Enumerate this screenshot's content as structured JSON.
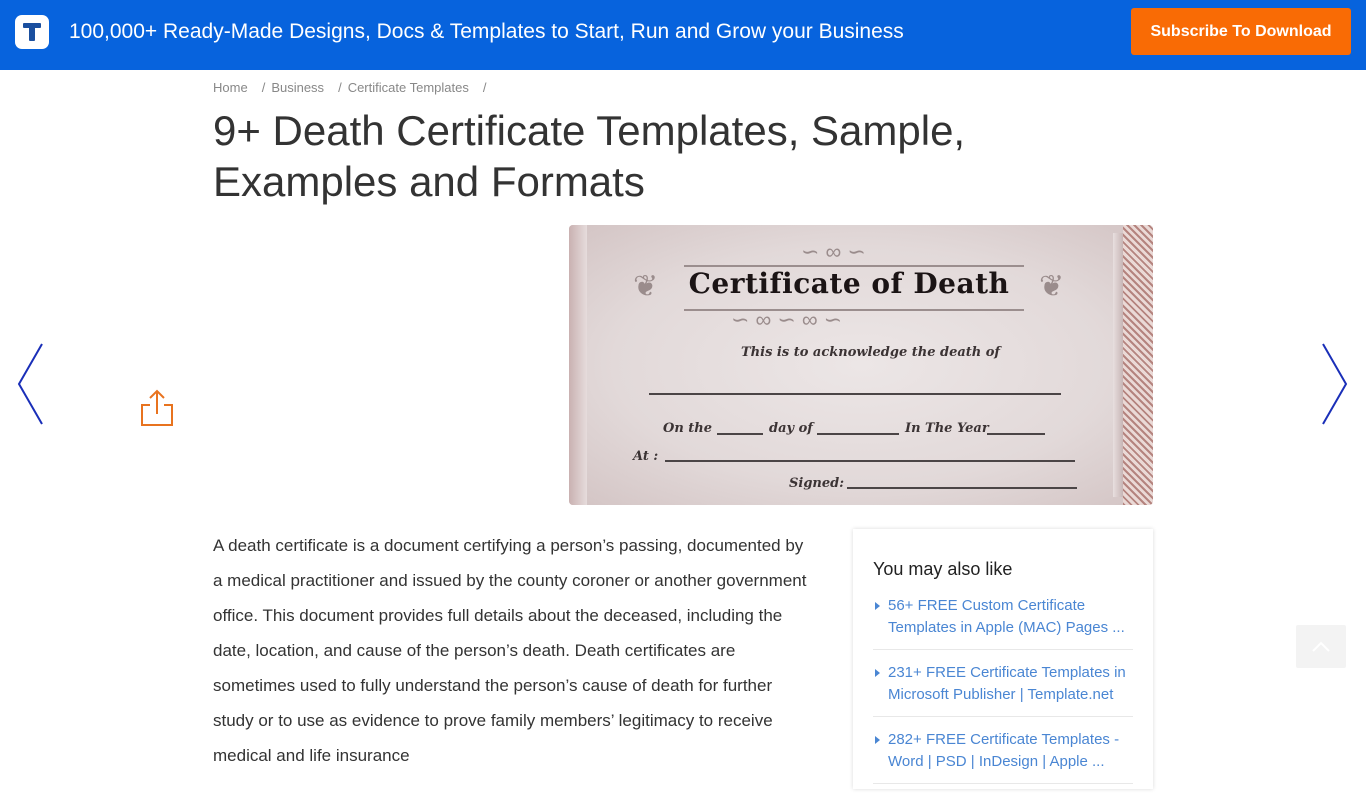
{
  "topbar": {
    "logo_icon": "template-t-logo",
    "tagline": "100,000+ Ready-Made Designs, Docs & Templates to Start, Run and Grow your Business",
    "subscribe_label": "Subscribe To Download",
    "brand_color": "#0763dd",
    "accent_color": "#f96b05"
  },
  "breadcrumb": {
    "items": [
      "Home",
      "Business",
      "Certificate Templates"
    ],
    "separator": "/"
  },
  "page": {
    "title": "9+ Death Certificate Templates, Sample, Examples and Formats"
  },
  "navigation": {
    "prev_icon": "chevron-left-icon",
    "next_icon": "chevron-right-icon",
    "share_icon": "share-icon",
    "scroll_top_icon": "chevron-up-icon"
  },
  "certificate": {
    "heading": "Certificate of Death",
    "line1": "This is to acknowledge the death of",
    "line2_a": "On the",
    "line2_b": "day of",
    "line2_c": "In The Year",
    "line3": "At :",
    "line4": "Signed:"
  },
  "article": {
    "paragraph": "A death certificate is a document certifying a person’s passing, documented by a medical practitioner and issued by the county coroner or another government office. This document provides full details about the deceased, including the date, location, and cause of the person’s death. Death certificates are sometimes used to fully understand the person’s cause of death for further study or to use as evidence to prove family members’ legitimacy to receive medical and life insurance"
  },
  "related": {
    "title": "You may also like",
    "items": [
      {
        "label": "56+ FREE Custom Certificate Templates in Apple (MAC) Pages ..."
      },
      {
        "label": "231+ FREE Certificate Templates in Microsoft Publisher | Template.net"
      },
      {
        "label": "282+ FREE Certificate Templates - Word | PSD | InDesign | Apple ..."
      }
    ]
  }
}
